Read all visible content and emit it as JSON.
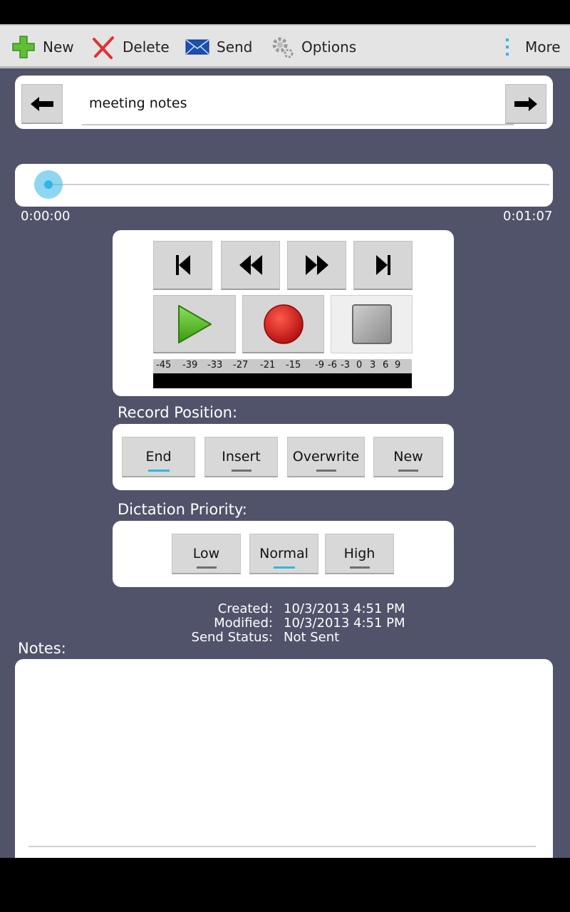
{
  "action_bar": {
    "new_label": "New",
    "delete_label": "Delete",
    "send_label": "Send",
    "options_label": "Options",
    "more_label": "More"
  },
  "dictation": {
    "title_value": "meeting notes",
    "position_current": "0:00:00",
    "position_total": "0:01:07",
    "progress_fraction": 0
  },
  "meter": {
    "scale_labels": [
      "-45",
      "-39",
      "-33",
      "-27",
      "-21",
      "-15",
      "-9",
      "-6",
      "-3",
      "0",
      "3",
      "6",
      "9"
    ]
  },
  "record_position": {
    "heading": "Record Position:",
    "options": [
      "End",
      "Insert",
      "Overwrite",
      "New"
    ],
    "selected": "End"
  },
  "priority": {
    "heading": "Dictation Priority:",
    "options": [
      "Low",
      "Normal",
      "High"
    ],
    "selected": "Normal"
  },
  "info": {
    "created_label": "Created:",
    "created_value": "10/3/2013 4:51 PM",
    "modified_label": "Modified:",
    "modified_value": "10/3/2013 4:51 PM",
    "status_label": "Send Status:",
    "status_value": "Not Sent"
  },
  "notes": {
    "heading": "Notes:",
    "value": ""
  },
  "colors": {
    "background": "#51536a",
    "accent": "#33b5e5",
    "play_green": "#4caf20",
    "record_red": "#d11a1a"
  }
}
